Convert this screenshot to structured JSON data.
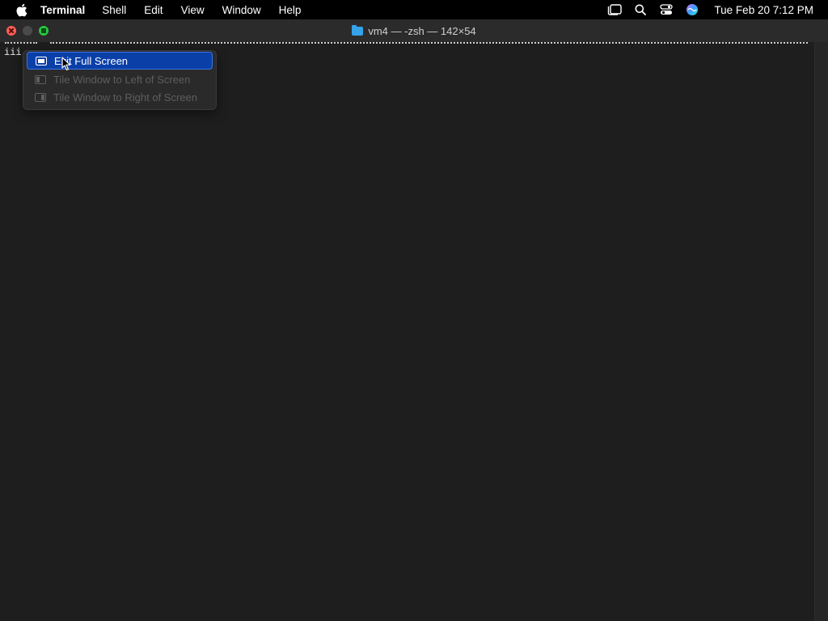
{
  "menubar": {
    "app_name": "Terminal",
    "items": [
      "Shell",
      "Edit",
      "View",
      "Window",
      "Help"
    ],
    "clock": "Tue Feb 20  7:12 PM",
    "icons": [
      "apple-icon",
      "stage-manager-icon",
      "search-icon",
      "control-center-icon",
      "siri-icon"
    ]
  },
  "window": {
    "title": "vm4 — -zsh — 142×54",
    "title_icon": "folder-icon"
  },
  "terminal": {
    "prompt_text": "iii"
  },
  "popup": {
    "items": [
      {
        "label": "Exit Full Screen",
        "enabled": true,
        "highlighted": true
      },
      {
        "label": "Tile Window to Left of Screen",
        "enabled": false
      },
      {
        "label": "Tile Window to Right of Screen",
        "enabled": false
      }
    ]
  },
  "colors": {
    "menubar_bg": "#000000",
    "terminal_bg": "#1e1e1e",
    "highlight": "#0a3fa8",
    "close": "#fe5f57",
    "zoom": "#28c840"
  }
}
